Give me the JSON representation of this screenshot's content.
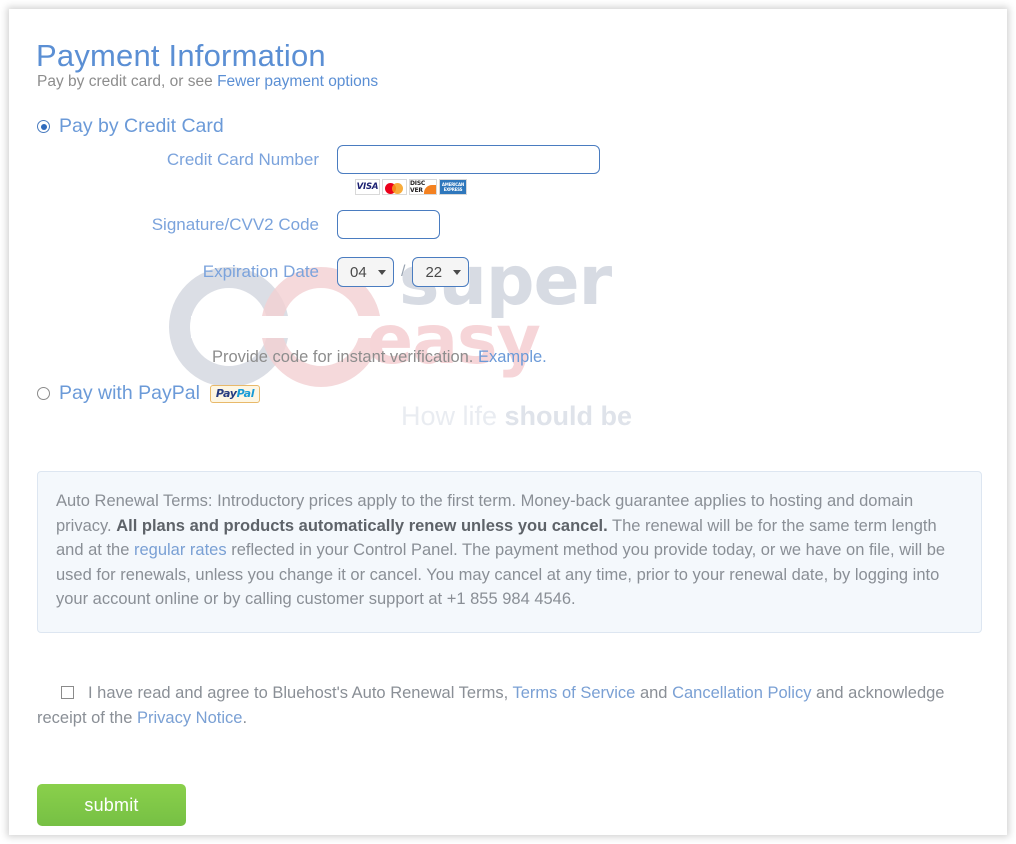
{
  "page": {
    "title": "Payment Information",
    "subtitle_prefix": "Pay by credit card, or see ",
    "subtitle_link": "Fewer payment options"
  },
  "credit_card": {
    "radio_label": "Pay by Credit Card",
    "selected": true,
    "number_label": "Credit Card Number",
    "number_value": "",
    "number_placeholder": "",
    "cvv_label": "Signature/CVV2 Code",
    "cvv_value": "",
    "cvv_placeholder": "",
    "expiration_label": "Expiration Date",
    "expiration_month": "04",
    "expiration_year": "22",
    "expiration_separator": "/",
    "hint_text": "Provide code for instant verification. ",
    "hint_link": "Example.",
    "card_logos": [
      {
        "name": "visa-logo",
        "text": "VISA"
      },
      {
        "name": "mastercard-logo",
        "text": ""
      },
      {
        "name": "discover-logo",
        "text": "DISC VER"
      },
      {
        "name": "amex-logo",
        "line1": "AMERICAN",
        "line2": "EXPRESS"
      }
    ]
  },
  "paypal": {
    "radio_label": "Pay with PayPal",
    "selected": false,
    "logo_part1": "Pay",
    "logo_part2": "Pal"
  },
  "terms": {
    "p1": "Auto Renewal Terms: Introductory prices apply to the first term. Money-back guarantee applies to hosting and domain privacy. ",
    "bold": "All plans and products automatically renew unless you cancel.",
    "p2": " The renewal will be for the same term length and at the ",
    "link": "regular rates",
    "p3": " reflected in your Control Panel. The payment method you provide today, or we have on file, will be used for renewals, unless you change it or cancel. You may cancel at any time, prior to your renewal date, by logging into your account online or by calling customer support at +1 855 984 4546."
  },
  "agreement": {
    "checked": false,
    "t1": "I have read and agree to Bluehost's Auto Renewal Terms, ",
    "link1": "Terms of Service",
    "t2": " and ",
    "link2": "Cancellation Policy",
    "t3": " and acknowledge receipt of the ",
    "link3": "Privacy Notice",
    "t4": "."
  },
  "actions": {
    "submit_label": "submit"
  },
  "watermark": {
    "word1": "super",
    "word2": "easy",
    "tagline_light": "How life ",
    "tagline_bold": "should be"
  },
  "colors": {
    "accent_blue": "#5b8fd4",
    "input_border": "#4a7cc0",
    "submit_green": "#7ec443",
    "terms_bg": "#f4f8fc"
  }
}
